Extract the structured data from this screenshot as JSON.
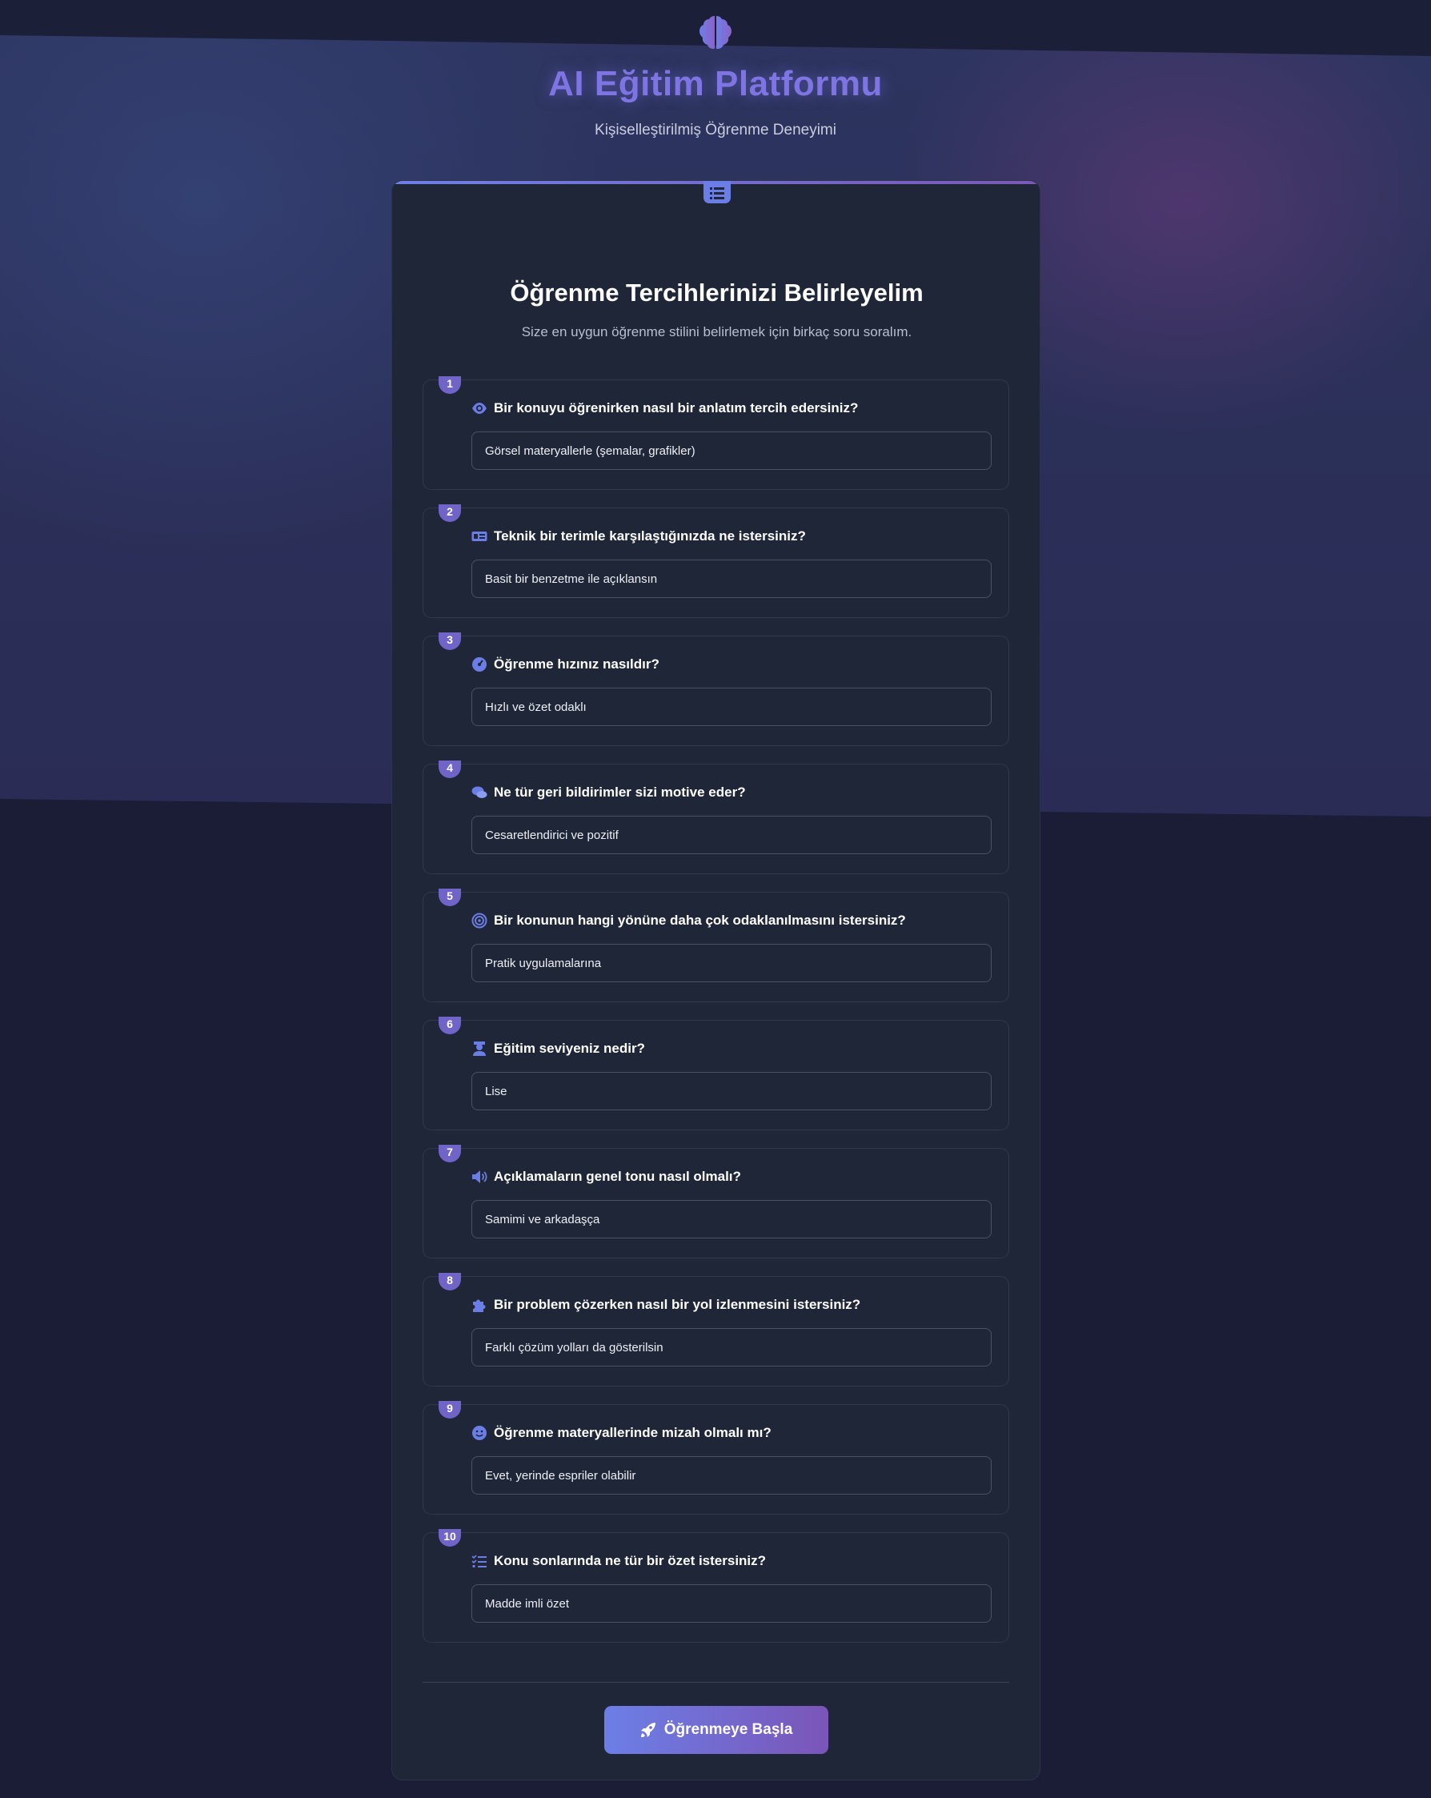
{
  "app": {
    "title": "AI Eğitim Platformu",
    "subtitle": "Kişiselleştirilmiş Öğrenme Deneyimi",
    "logo_icon": "brain-icon"
  },
  "card": {
    "icon": "list-icon",
    "title": "Öğrenme Tercihlerinizi Belirleyelim",
    "description": "Size en uygun öğrenme stilini belirlemek için birkaç soru soralım."
  },
  "questions": [
    {
      "number": "1",
      "icon": "eye-icon",
      "label": "Bir konuyu öğrenirken nasıl bir anlatım tercih edersiniz?",
      "value": "Görsel materyallerle (şemalar, grafikler)"
    },
    {
      "number": "2",
      "icon": "id-card-icon",
      "label": "Teknik bir terimle karşılaştığınızda ne istersiniz?",
      "value": "Basit bir benzetme ile açıklansın"
    },
    {
      "number": "3",
      "icon": "gauge-icon",
      "label": "Öğrenme hızınız nasıldır?",
      "value": "Hızlı ve özet odaklı"
    },
    {
      "number": "4",
      "icon": "comments-icon",
      "label": "Ne tür geri bildirimler sizi motive eder?",
      "value": "Cesaretlendirici ve pozitif"
    },
    {
      "number": "5",
      "icon": "target-icon",
      "label": "Bir konunun hangi yönüne daha çok odaklanılmasını istersiniz?",
      "value": "Pratik uygulamalarına"
    },
    {
      "number": "6",
      "icon": "graduate-icon",
      "label": "Eğitim seviyeniz nedir?",
      "value": "Lise"
    },
    {
      "number": "7",
      "icon": "speaker-icon",
      "label": "Açıklamaların genel tonu nasıl olmalı?",
      "value": "Samimi ve arkadaşça"
    },
    {
      "number": "8",
      "icon": "puzzle-icon",
      "label": "Bir problem çözerken nasıl bir yol izlenmesini istersiniz?",
      "value": "Farklı çözüm yolları da gösterilsin"
    },
    {
      "number": "9",
      "icon": "smile-icon",
      "label": "Öğrenme materyallerinde mizah olmalı mı?",
      "value": "Evet, yerinde espriler olabilir"
    },
    {
      "number": "10",
      "icon": "checklist-icon",
      "label": "Konu sonlarında ne tür bir özet istersiniz?",
      "value": "Madde imli özet"
    }
  ],
  "actions": {
    "start_label": "Öğrenmeye Başla",
    "start_icon": "rocket-icon"
  },
  "colors": {
    "accent": "#6b7de6",
    "accent_purple": "#7b55b8",
    "badge": "#7064c8",
    "card_bg": "#1f2637",
    "page_bg": "#1a1d35"
  }
}
